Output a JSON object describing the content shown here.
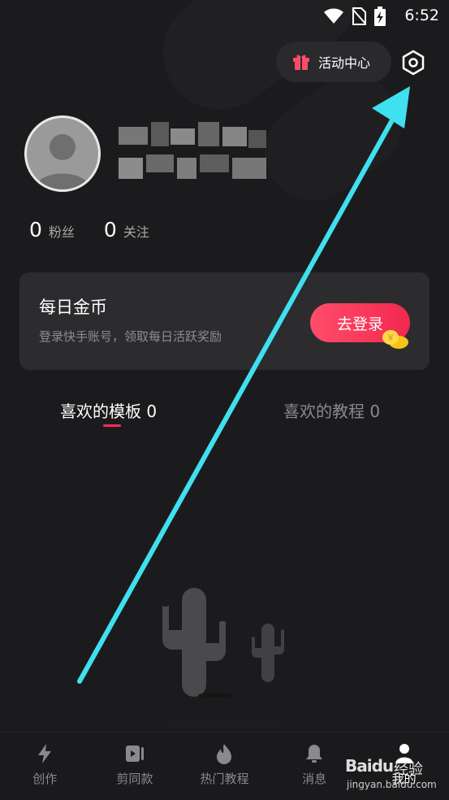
{
  "status_bar": {
    "time": "6:52",
    "icons": [
      "wifi-icon",
      "no-sim-icon",
      "battery-charging-icon"
    ]
  },
  "header": {
    "activity_label": "活动中心",
    "settings_icon": "settings-hexagon-icon"
  },
  "profile": {
    "followers_count": "0",
    "followers_label": "粉丝",
    "following_count": "0",
    "following_label": "关注"
  },
  "coin_card": {
    "title": "每日金币",
    "subtitle": "登录快手账号，领取每日活跃奖励",
    "login_label": "去登录"
  },
  "tabs": [
    {
      "label": "喜欢的模板 0",
      "active": true
    },
    {
      "label": "喜欢的教程 0",
      "active": false
    }
  ],
  "bottom_nav": [
    {
      "label": "创作",
      "icon": "lightning-icon"
    },
    {
      "label": "剪同款",
      "icon": "video-icon"
    },
    {
      "label": "热门教程",
      "icon": "flame-icon"
    },
    {
      "label": "消息",
      "icon": "bell-icon"
    },
    {
      "label": "我的",
      "icon": "person-icon",
      "active": true
    }
  ],
  "watermark": {
    "brand": "Baidu",
    "brand_suffix": "经验",
    "url": "jingyan.baidu.com"
  },
  "colors": {
    "accent": "#fe2c55",
    "background": "#1b1b1d",
    "card": "#2c2c2f",
    "annotation_arrow": "#3fe0f0"
  }
}
